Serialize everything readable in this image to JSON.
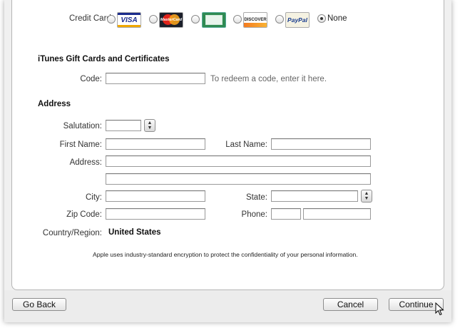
{
  "payment": {
    "label": "Credit Card:",
    "options": [
      {
        "name": "visa",
        "text": "VISA",
        "selected": false
      },
      {
        "name": "mastercard",
        "text": "MasterCard",
        "selected": false
      },
      {
        "name": "amex",
        "text": "",
        "selected": false
      },
      {
        "name": "discover",
        "text": "DISCOVER",
        "selected": false
      },
      {
        "name": "paypal",
        "text": "PayPal",
        "selected": false
      },
      {
        "name": "none",
        "text": "None",
        "selected": true
      }
    ]
  },
  "gift": {
    "heading": "iTunes Gift Cards and Certificates",
    "code_label": "Code:",
    "code_value": "",
    "code_hint": "To redeem a code, enter it here."
  },
  "address": {
    "heading": "Address",
    "salutation_label": "Salutation:",
    "salutation_value": "",
    "first_name_label": "First Name:",
    "first_name_value": "",
    "last_name_label": "Last Name:",
    "last_name_value": "",
    "address_label": "Address:",
    "address_line1": "",
    "address_line2": "",
    "city_label": "City:",
    "city_value": "",
    "state_label": "State:",
    "state_value": "",
    "zip_label": "Zip Code:",
    "zip_value": "",
    "phone_label": "Phone:",
    "phone_area": "",
    "phone_number": "",
    "country_label": "Country/Region:",
    "country_value": "United States"
  },
  "footnote": "Apple uses industry-standard encryption to protect the confidentiality of your personal information.",
  "buttons": {
    "go_back": "Go Back",
    "cancel": "Cancel",
    "continue": "Continue"
  }
}
